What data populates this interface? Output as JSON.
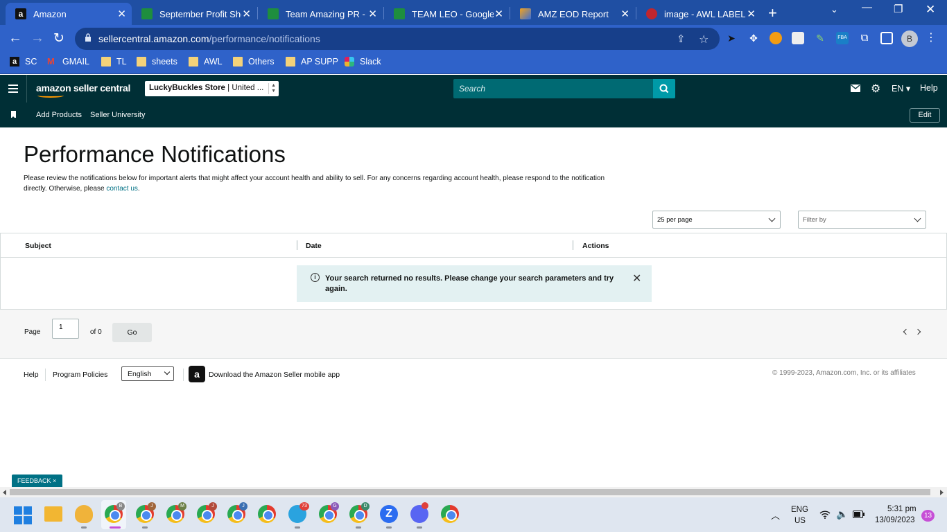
{
  "browser": {
    "tabs": [
      {
        "title": "Amazon",
        "active": true
      },
      {
        "title": "September Profit Shee",
        "active": false
      },
      {
        "title": "Team Amazing PR - Go",
        "active": false
      },
      {
        "title": "TEAM LEO - Google She",
        "active": false
      },
      {
        "title": "AMZ EOD Report",
        "active": false
      },
      {
        "title": "image - AWL LABEL",
        "active": false
      }
    ],
    "url_host": "sellercentral.amazon.com",
    "url_path": "/performance/notifications",
    "profile_initial": "B",
    "bookmarks": [
      "SC",
      "GMAIL",
      "TL",
      "sheets",
      "AWL",
      "Others",
      "AP SUPP",
      "Slack"
    ]
  },
  "seller_central": {
    "logo_text": "amazon seller central",
    "store_name": "LuckyBuckles Store",
    "store_region": "United ...",
    "search_placeholder": "Search",
    "lang": "EN",
    "help": "Help",
    "subnav": [
      "Add Products",
      "Seller University"
    ],
    "edit_label": "Edit"
  },
  "page": {
    "title": "Performance Notifications",
    "description_pre": "Please review the notifications below for important alerts that might affect your account health and ability to sell. For any concerns regarding account health, please respond to the notification directly. Otherwise, please ",
    "description_link": "contact us",
    "description_post": ".",
    "per_page": "25 per page",
    "filter_placeholder": "Filter by",
    "columns": [
      "Subject",
      "Date",
      "Actions"
    ],
    "alert_message": "Your search returned no results. Please change your search parameters and try again.",
    "pager": {
      "page_label": "Page",
      "page_value": "1",
      "of_label": "of 0",
      "go_label": "Go"
    }
  },
  "footer": {
    "links": [
      "Help",
      "Program Policies"
    ],
    "language": "English",
    "app_text": "Download the Amazon Seller mobile app",
    "copyright": "© 1999-2023, Amazon.com, Inc. or its affiliates"
  },
  "feedback_label": "FEEDBACK ×",
  "taskbar": {
    "lang_top": "ENG",
    "lang_bottom": "US",
    "time": "5:31 pm",
    "date": "13/09/2023",
    "notif_count": "13",
    "telegram_badge": "73"
  },
  "colors": {
    "tab_bar": "#1f4fa3",
    "address_bar": "#2f62c9",
    "sc_nav": "#002f36",
    "accent_teal": "#007185"
  }
}
